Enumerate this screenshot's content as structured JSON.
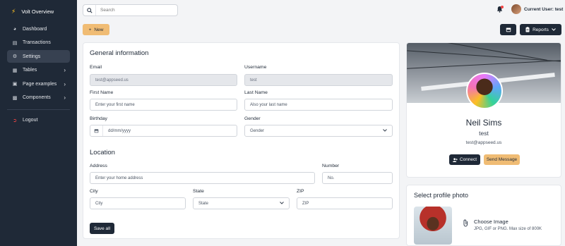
{
  "sidebar": {
    "brand": "Volt Overview",
    "items": [
      {
        "label": "Dashboard",
        "icon": "chart-pie-icon"
      },
      {
        "label": "Transactions",
        "icon": "credit-card-icon"
      },
      {
        "label": "Settings",
        "icon": "gear-icon",
        "active": true
      },
      {
        "label": "Tables",
        "icon": "table-icon",
        "chevron": true
      },
      {
        "label": "Page examples",
        "icon": "file-icon",
        "chevron": true
      },
      {
        "label": "Components",
        "icon": "box-icon",
        "chevron": true
      }
    ],
    "logout": "Logout"
  },
  "topbar": {
    "search_placeholder": "Search",
    "user_label": "Current User: test"
  },
  "toolbar": {
    "new_label": "New",
    "reports_label": "Reports"
  },
  "general": {
    "title": "General information",
    "email_label": "Email",
    "email_value": "test@appseed.us",
    "username_label": "Username",
    "username_value": "test",
    "first_name_label": "First Name",
    "first_name_placeholder": "Enter your first name",
    "last_name_label": "Last Name",
    "last_name_placeholder": "Also your last name",
    "birthday_label": "Birthday",
    "birthday_placeholder": "dd/mm/yyyy",
    "gender_label": "Gender",
    "gender_value": "Gender"
  },
  "location": {
    "title": "Location",
    "address_label": "Address",
    "address_placeholder": "Enter your home address",
    "number_label": "Number",
    "number_placeholder": "No.",
    "city_label": "City",
    "city_placeholder": "City",
    "state_label": "State",
    "state_value": "State",
    "zip_label": "ZIP",
    "zip_placeholder": "ZIP"
  },
  "save_label": "Save all",
  "profile": {
    "name": "Neil Sims",
    "username": "test",
    "email": "test@appseed.us",
    "connect_label": "Connect",
    "message_label": "Send Message"
  },
  "photo": {
    "title": "Select profile photo",
    "choose_label": "Choose Image",
    "hint": "JPG, GIF or PNG. Max size of 800K"
  },
  "colors": {
    "sidebar_bg": "#1f2937",
    "accent": "#f0bc74",
    "alert": "#ef4444"
  }
}
